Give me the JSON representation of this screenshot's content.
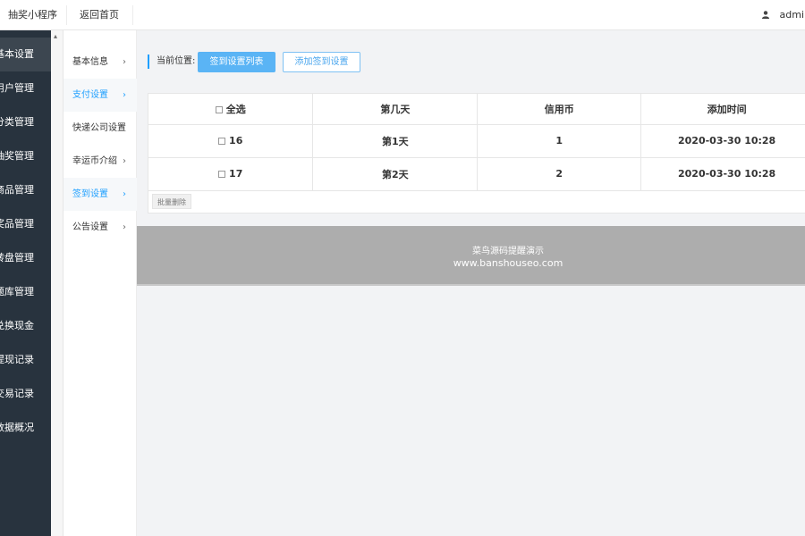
{
  "topbar": {
    "app_title": "抽奖小程序",
    "back_home": "返回首页",
    "user_name": "admin"
  },
  "leftnav": {
    "items": [
      {
        "label": "基本设置",
        "active": true
      },
      {
        "label": "用户管理"
      },
      {
        "label": "分类管理"
      },
      {
        "label": "抽奖管理"
      },
      {
        "label": "商品管理"
      },
      {
        "label": "奖品管理"
      },
      {
        "label": "转盘管理"
      },
      {
        "label": "题库管理"
      },
      {
        "label": "兑换现金"
      },
      {
        "label": "提现记录"
      },
      {
        "label": "交易记录"
      },
      {
        "label": "数据概况"
      }
    ]
  },
  "submenu": {
    "items": [
      {
        "label": "基本信息",
        "chevron": "›",
        "highlighted": false
      },
      {
        "label": "支付设置",
        "chevron": "›",
        "highlighted": true
      },
      {
        "label": "快递公司设置",
        "chevron": "",
        "highlighted": false
      },
      {
        "label": "幸运币介绍",
        "chevron": "›",
        "highlighted": false
      },
      {
        "label": "签到设置",
        "chevron": "›",
        "highlighted": true
      },
      {
        "label": "公告设置",
        "chevron": "›",
        "highlighted": false
      }
    ]
  },
  "main": {
    "location_label": "当前位置:",
    "btn_list": "签到设置列表",
    "btn_add": "添加签到设置",
    "table": {
      "select_all": "全选",
      "headers": [
        "第几天",
        "信用币",
        "添加时间"
      ],
      "rows": [
        {
          "id": "16",
          "day": "第1天",
          "coins": "1",
          "time": "2020-03-30 10:28"
        },
        {
          "id": "17",
          "day": "第2天",
          "coins": "2",
          "time": "2020-03-30 10:28"
        }
      ]
    },
    "batch_delete": "批量删除",
    "footer_line1": "菜鸟源码提醒演示",
    "footer_line2": "www.banshouseo.com"
  },
  "colors": {
    "primary": "#1e9fff",
    "nav_bg": "#28333e",
    "footer_bg": "#adadad"
  }
}
